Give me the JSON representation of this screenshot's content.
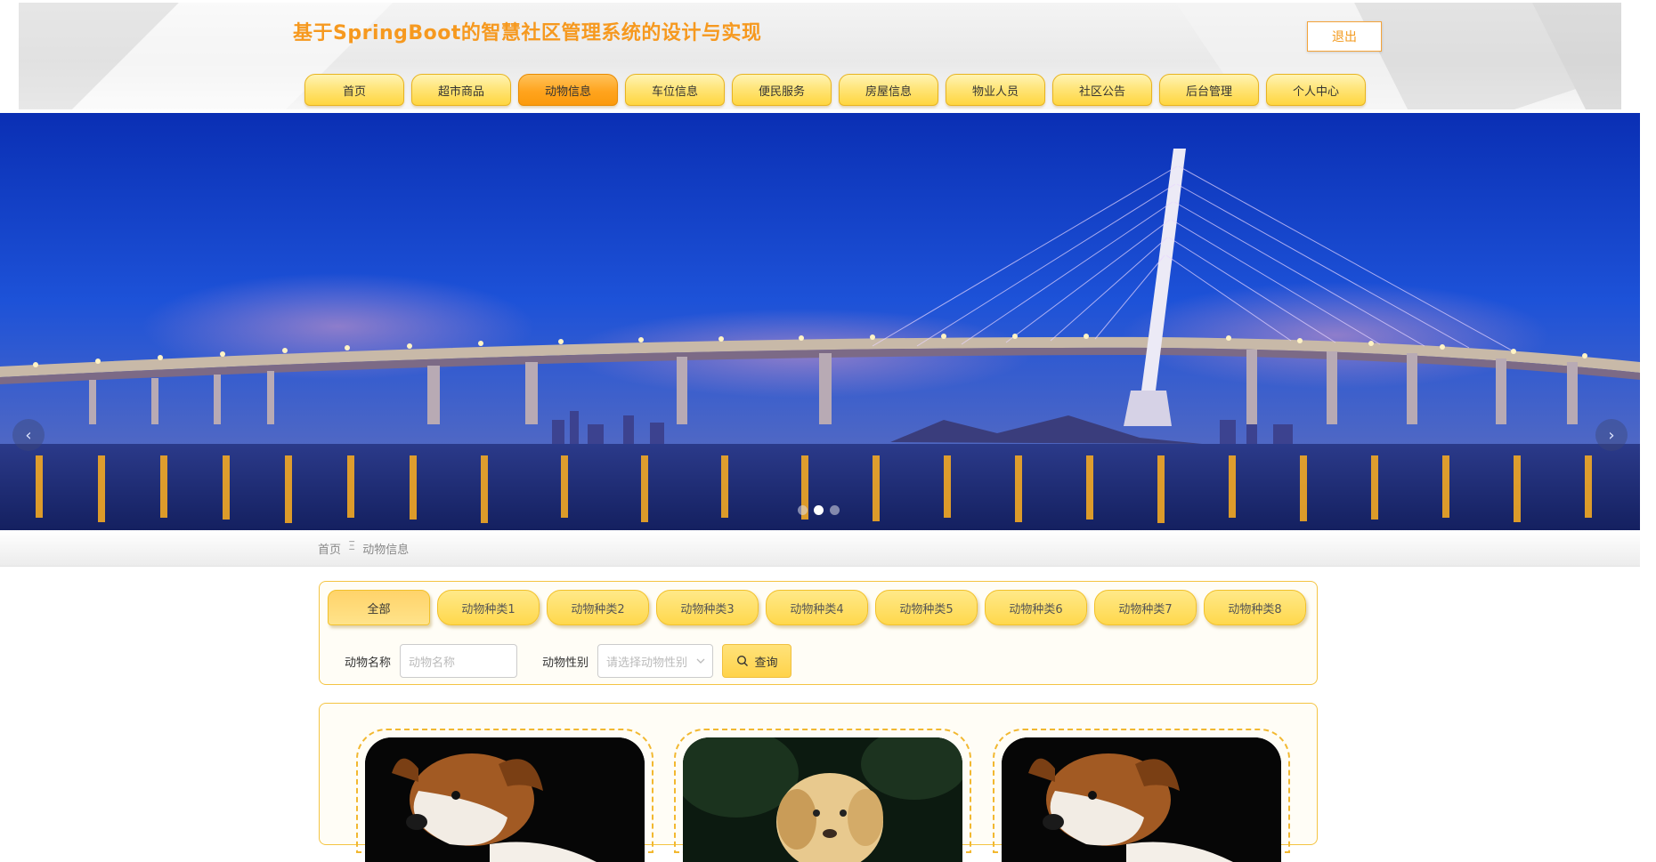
{
  "site": {
    "title": "基于SpringBoot的智慧社区管理系统的设计与实现",
    "logout_label": "退出"
  },
  "nav": {
    "items": [
      {
        "label": "首页"
      },
      {
        "label": "超市商品"
      },
      {
        "label": "动物信息"
      },
      {
        "label": "车位信息"
      },
      {
        "label": "便民服务"
      },
      {
        "label": "房屋信息"
      },
      {
        "label": "物业人员"
      },
      {
        "label": "社区公告"
      },
      {
        "label": "后台管理"
      },
      {
        "label": "个人中心"
      }
    ],
    "active_index": 2
  },
  "carousel": {
    "prev_icon": "‹",
    "next_icon": "›",
    "slide_count": 3,
    "active_slide": 1
  },
  "breadcrumb": {
    "home": "首页",
    "separator": "Ξ",
    "current": "动物信息"
  },
  "categories": {
    "items": [
      "全部",
      "动物种类1",
      "动物种类2",
      "动物种类3",
      "动物种类4",
      "动物种类5",
      "动物种类6",
      "动物种类7",
      "动物种类8"
    ],
    "active_index": 0
  },
  "search": {
    "name_label": "动物名称",
    "name_placeholder": "动物名称",
    "gender_label": "动物性别",
    "gender_placeholder": "请选择动物性别",
    "query_label": "查询"
  },
  "cards": [
    {
      "animal": "dog-brown-white"
    },
    {
      "animal": "dog-golden"
    },
    {
      "animal": "dog-brown-white"
    }
  ],
  "colors": {
    "accent": "#f6991f",
    "nav_gold": "#ffd63f",
    "nav_active": "#fb9a0c",
    "panel_border": "#f4c442"
  }
}
